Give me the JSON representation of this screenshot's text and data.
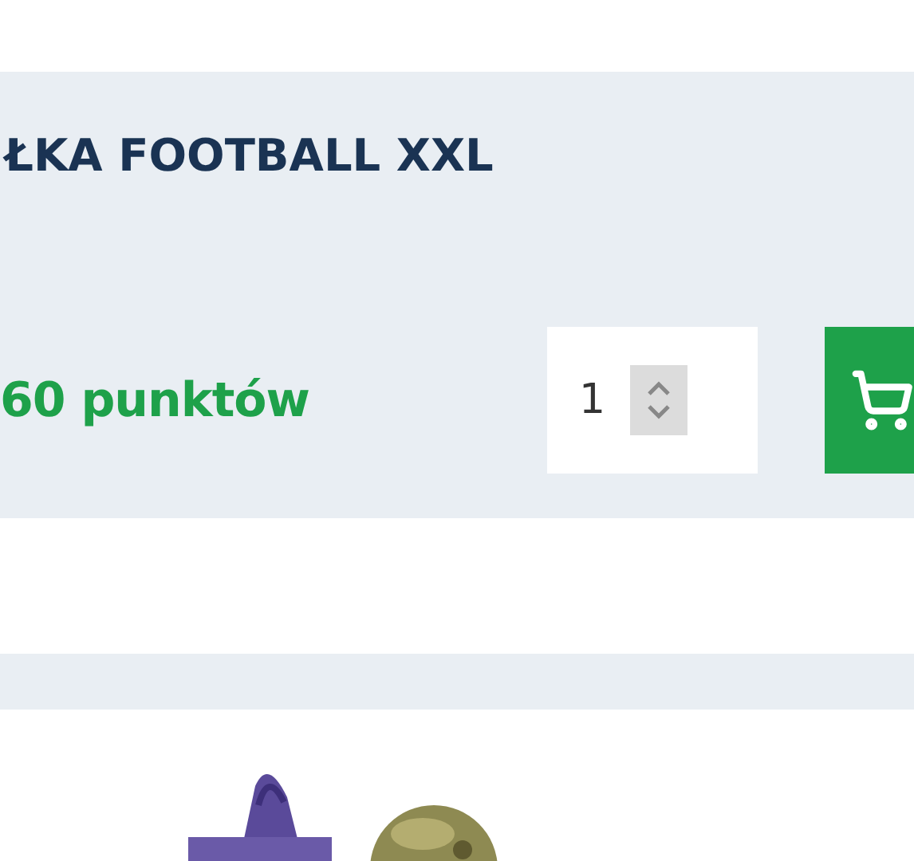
{
  "product": {
    "title": "ŁKA FOOTBALL XXL",
    "price": "60 punktów",
    "quantity": "1"
  }
}
